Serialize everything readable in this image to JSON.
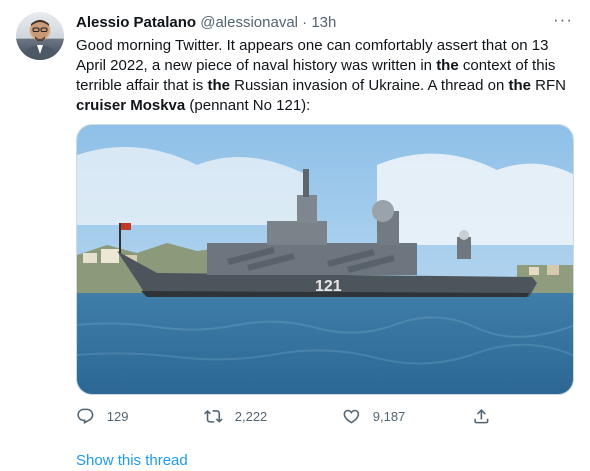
{
  "tweet": {
    "author_name": "Alessio Patalano",
    "author_handle": "@alessionaval",
    "separator": "·",
    "time": "13h",
    "more_label": "···",
    "text_parts": [
      "Good morning Twitter. It appears one can comfortably assert that on 13 April 2022, a new piece of naval history was written in ",
      "the",
      " context of this terrible affair that is ",
      "the",
      " Russian invasion of Ukraine. A thread on ",
      "the",
      " RFN ",
      "cruiser Moskva",
      " (pennant No 121):"
    ],
    "image": {
      "hull_number": "121"
    }
  },
  "actions": {
    "replies": "129",
    "retweets": "2,222",
    "likes": "9,187"
  },
  "links": {
    "show_thread": "Show this thread"
  },
  "colors": {
    "accent": "#1d9bf0",
    "secondary_text": "#536471",
    "primary_text": "#0f1419"
  }
}
